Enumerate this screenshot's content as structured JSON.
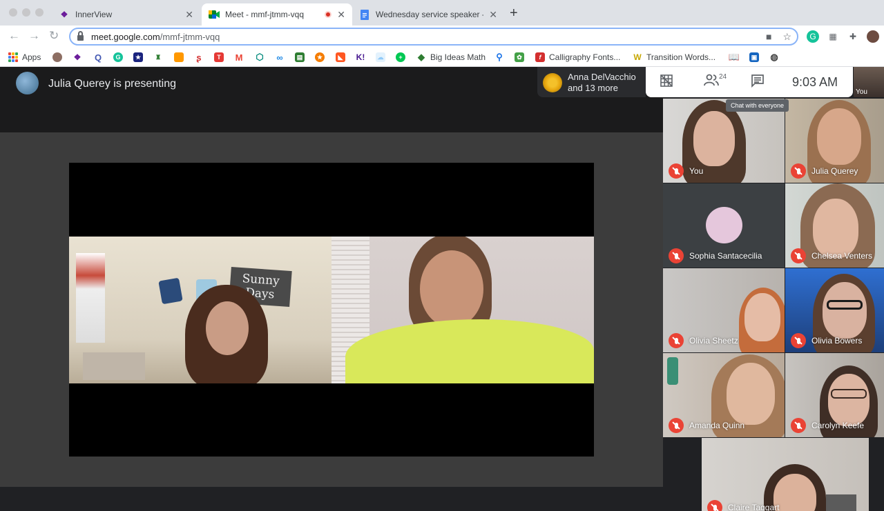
{
  "browser": {
    "tabs": [
      {
        "title": "InnerView"
      },
      {
        "title": "Meet - mmf-jtmm-vqq"
      },
      {
        "title": "Wednesday service speaker - "
      }
    ],
    "url_host": "meet.google.com",
    "url_path": "/mmf-jtmm-vqq",
    "bookmarks": [
      {
        "label": "Apps"
      },
      {
        "label": "Big Ideas Math"
      },
      {
        "label": "Calligraphy Fonts..."
      },
      {
        "label": "Transition Words..."
      }
    ]
  },
  "meet": {
    "presenter_text": "Julia Querey is presenting",
    "chip_line1": "Anna DelVacchio",
    "chip_line2": "and 13 more",
    "participants_badge": "24",
    "clock": "9:03  AM",
    "tooltip": "Chat with everyone",
    "self_label": "You",
    "shared_sign_text": "Sunny Days"
  },
  "tiles": [
    {
      "name": "You"
    },
    {
      "name": "Julia Querey"
    },
    {
      "name": "Sophia Santacecilia"
    },
    {
      "name": "Chelsea Venters"
    },
    {
      "name": "Olivia Sheetz"
    },
    {
      "name": "Olivia Bowers"
    },
    {
      "name": "Amanda Quinn"
    },
    {
      "name": "Carolyn Keefe"
    },
    {
      "name": "Claire Taggart"
    }
  ]
}
